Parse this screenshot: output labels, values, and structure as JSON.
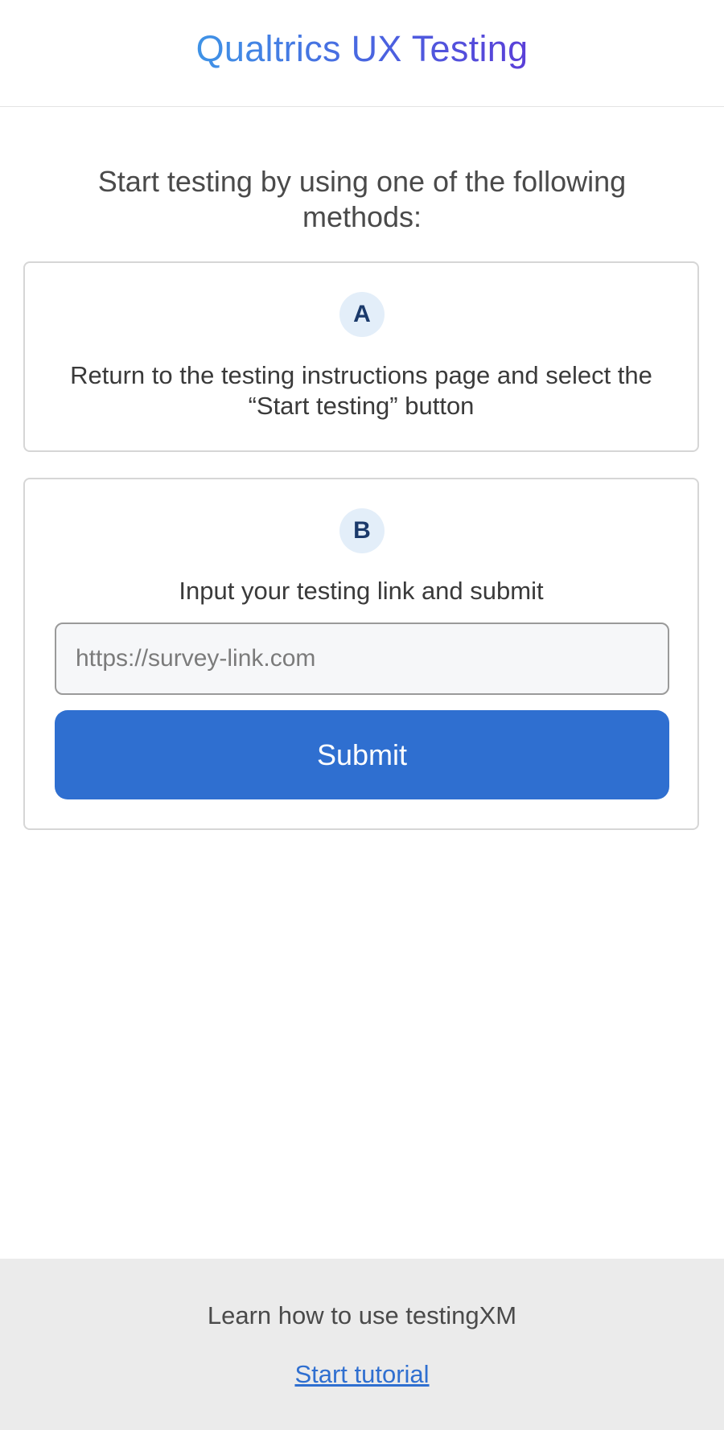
{
  "header": {
    "title": "Qualtrics UX Testing"
  },
  "main": {
    "intro": "Start testing by using one of the following methods:",
    "method_a": {
      "badge": "A",
      "text": "Return to the testing instructions page and select the “Start testing” button"
    },
    "method_b": {
      "badge": "B",
      "text": "Input your testing link and submit",
      "input_placeholder": "https://survey-link.com",
      "input_value": "",
      "submit_label": "Submit"
    }
  },
  "footer": {
    "text": "Learn how to use testingXM",
    "link_label": "Start tutorial"
  },
  "colors": {
    "accent": "#2f6fd0",
    "badge_bg": "#e3eef9",
    "footer_bg": "#ebebeb"
  }
}
